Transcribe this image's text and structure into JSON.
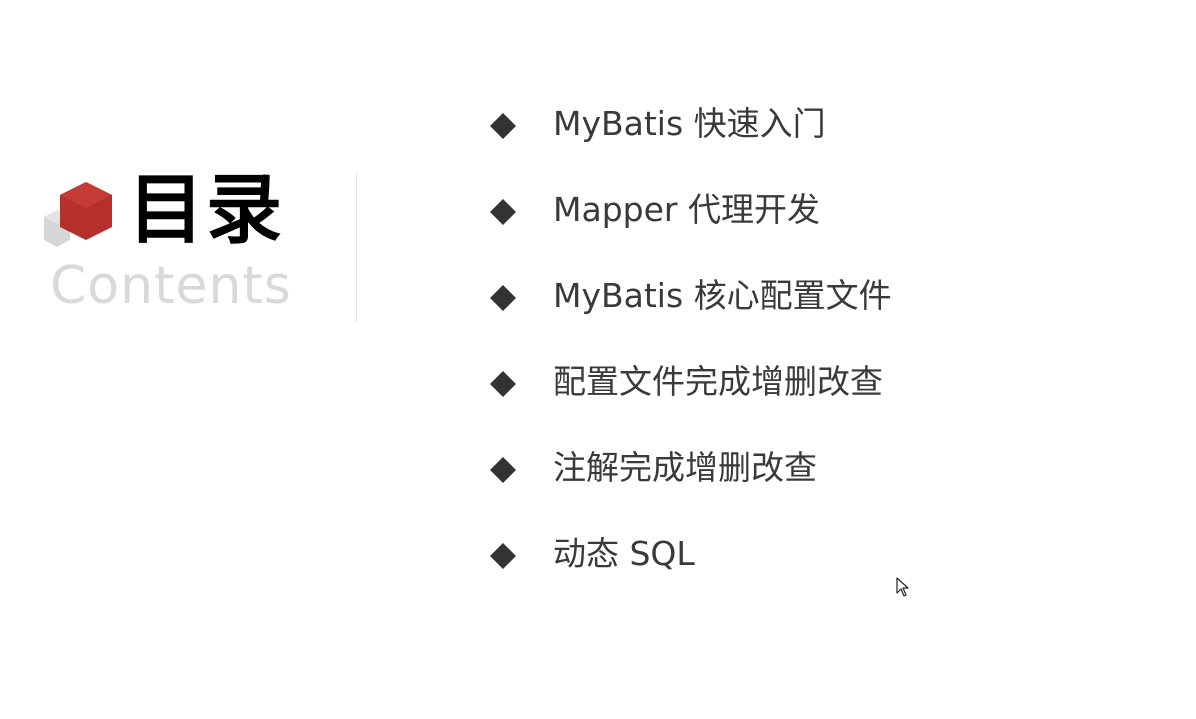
{
  "slide": {
    "title_cn": "目录",
    "title_en": "Contents",
    "agenda": [
      {
        "label": "MyBatis 快速入门"
      },
      {
        "label": "Mapper 代理开发"
      },
      {
        "label": "MyBatis 核心配置文件"
      },
      {
        "label": "配置文件完成增删改查"
      },
      {
        "label": "注解完成增删改查"
      },
      {
        "label": "动态 SQL"
      }
    ],
    "colors": {
      "accent_red": "#b5302d",
      "logo_gray": "#d6d6d6",
      "bullet": "#333333",
      "text": "#3a3a3a",
      "subtitle": "#d9d9d9"
    },
    "icons": {
      "logo": "hexagon-cubes-icon",
      "bullet": "diamond-bullet-icon",
      "cursor": "mouse-pointer-icon"
    }
  }
}
